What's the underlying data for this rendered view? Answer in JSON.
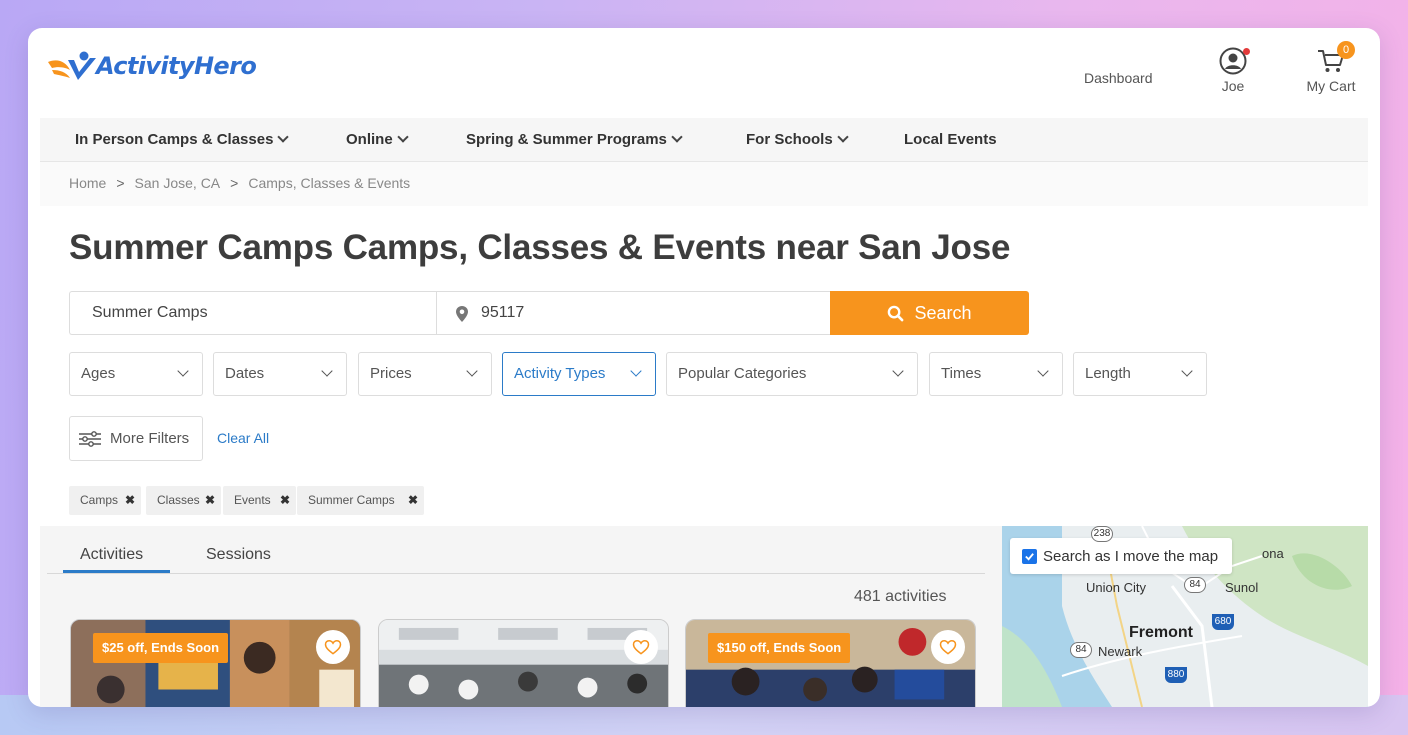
{
  "header": {
    "logo_text": "ActivityHero",
    "dashboard_label": "Dashboard",
    "user_label": "Joe",
    "cart_label": "My Cart",
    "cart_count": "0"
  },
  "nav": {
    "items": [
      {
        "label": "In Person Camps & Classes"
      },
      {
        "label": "Online"
      },
      {
        "label": "Spring & Summer Programs"
      },
      {
        "label": "For Schools"
      },
      {
        "label": "Local Events"
      }
    ]
  },
  "breadcrumb": {
    "items": [
      "Home",
      "San Jose, CA",
      "Camps, Classes & Events"
    ],
    "separator": ">"
  },
  "page": {
    "title": "Summer Camps Camps, Classes & Events near San Jose"
  },
  "search": {
    "keyword_value": "Summer Camps",
    "location_value": "95117",
    "button_label": "Search"
  },
  "filters": {
    "items": [
      "Ages",
      "Dates",
      "Prices",
      "Activity Types",
      "Popular Categories",
      "Times",
      "Length"
    ],
    "active": "Activity Types",
    "more_filters_label": "More Filters",
    "clear_all_label": "Clear All"
  },
  "chips": [
    "Camps",
    "Classes",
    "Events",
    "Summer Camps"
  ],
  "results": {
    "tabs": [
      "Activities",
      "Sessions"
    ],
    "active_tab": "Activities",
    "count_text": "481 activities",
    "cards": [
      {
        "promo": "$25 off, Ends Soon"
      },
      {
        "promo": ""
      },
      {
        "promo": "$150 off, Ends Soon"
      }
    ]
  },
  "map": {
    "search_as_move_label": "Search as I move the map",
    "checked": true,
    "labels": [
      "Union City",
      "Sunol",
      "Fremont",
      "Newark",
      "ona"
    ],
    "highways": [
      "238",
      "84",
      "680",
      "84",
      "880"
    ]
  },
  "colors": {
    "brand_orange": "#f7941d",
    "brand_blue": "#2b7bc8",
    "logo_blue": "#2f6fd0"
  }
}
